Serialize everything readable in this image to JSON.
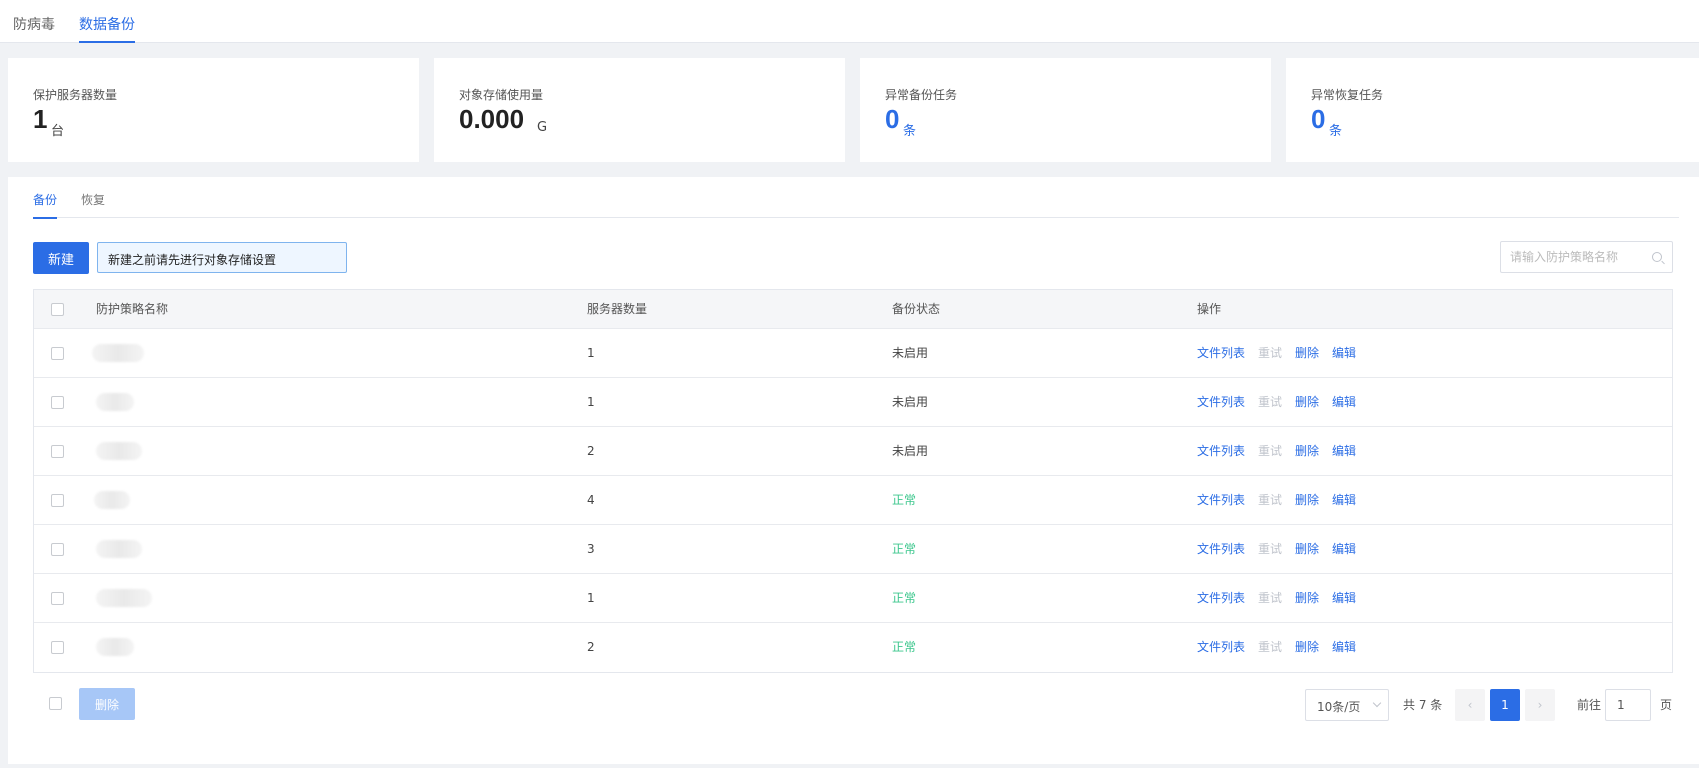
{
  "top_tabs": [
    "防病毒",
    "数据备份"
  ],
  "stats": [
    {
      "label": "保护服务器数量",
      "value": "1",
      "unit": "台",
      "accent": false
    },
    {
      "label": "对象存储使用量",
      "value": "0.000",
      "unit": "G",
      "accent": false
    },
    {
      "label": "异常备份任务",
      "value": "0",
      "unit": "条",
      "accent": true
    },
    {
      "label": "异常恢复任务",
      "value": "0",
      "unit": "条",
      "accent": true
    }
  ],
  "sub_tabs": [
    "备份",
    "恢复"
  ],
  "toolbar": {
    "new_label": "新建",
    "tip": "新建之前请先进行对象存储设置",
    "search_placeholder": "请输入防护策略名称"
  },
  "table": {
    "headers": [
      "防护策略名称",
      "服务器数量",
      "备份状态",
      "操作"
    ],
    "rows": [
      {
        "count": "1",
        "status": "未启用"
      },
      {
        "count": "1",
        "status": "未启用"
      },
      {
        "count": "2",
        "status": "未启用"
      },
      {
        "count": "4",
        "status": "正常"
      },
      {
        "count": "3",
        "status": "正常"
      },
      {
        "count": "1",
        "status": "正常"
      },
      {
        "count": "2",
        "status": "正常"
      }
    ],
    "ops": [
      "文件列表",
      "重试",
      "删除",
      "编辑"
    ]
  },
  "footer": {
    "delete_label": "删除",
    "page_size": "10条/页",
    "total": "共 7 条",
    "current_page": "1",
    "goto_label": "前往",
    "goto_value": "1",
    "goto_unit": "页"
  },
  "colors": {
    "accent": "#2b6de5",
    "status_ok": "#3cc78d"
  }
}
